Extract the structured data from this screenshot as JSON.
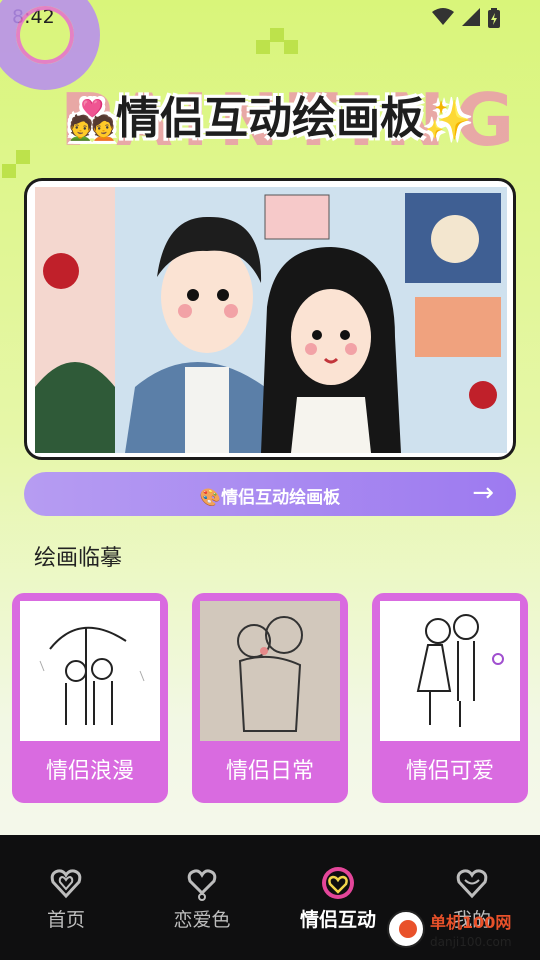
{
  "status_bar": {
    "time": "8:42"
  },
  "header": {
    "bg_word": "PAINTING",
    "title": "情侣互动绘画板",
    "emoji_left": "💑",
    "emoji_right": "✨"
  },
  "cta": {
    "icon": "🎨",
    "label": "情侣互动绘画板",
    "arrow": "→"
  },
  "section": {
    "title": "绘画临摹"
  },
  "cards": [
    {
      "label": "情侣浪漫"
    },
    {
      "label": "情侣日常"
    },
    {
      "label": "情侣可爱"
    }
  ],
  "tabs": [
    {
      "label": "首页",
      "icon": "heart-outline-icon"
    },
    {
      "label": "恋爱色",
      "icon": "heart-chat-icon"
    },
    {
      "label": "情侣互动",
      "icon": "heart-circle-icon",
      "active": true
    },
    {
      "label": "我的",
      "icon": "heart-user-icon"
    }
  ],
  "watermark": {
    "text": "单机100网",
    "sub": "danji100.com"
  },
  "colors": {
    "accent": "#d96be0",
    "cta": "#9d7af0",
    "brand_bg": "#d9f57a"
  }
}
